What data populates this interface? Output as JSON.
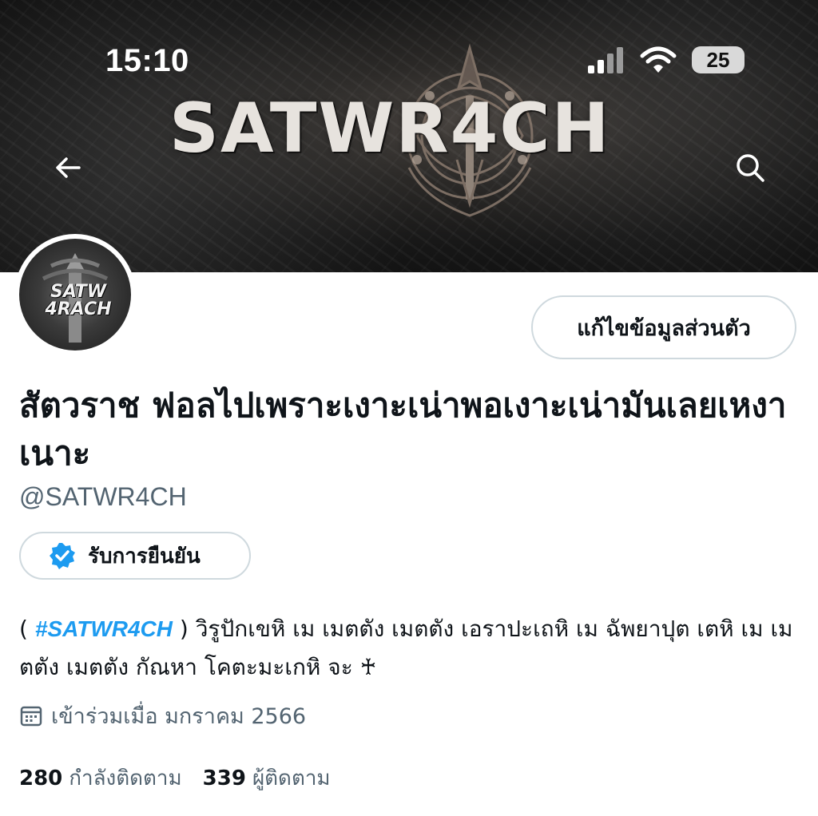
{
  "status_bar": {
    "time": "15:10",
    "battery": "25",
    "icons": [
      "signal-icon",
      "wifi-icon",
      "battery-icon"
    ]
  },
  "header": {
    "banner_text": "SATWR4CH",
    "back_icon": "arrow-left-icon",
    "search_icon": "search-icon"
  },
  "profile": {
    "avatar_text_line1": "SATW",
    "avatar_text_line2": "4RACH",
    "edit_button_label": "แก้ไขข้อมูลส่วนตัว",
    "display_name": "สัตวราช ฟอลไปเพราะเงาะเน่าพอเงาะเน่ามันเลยเหงาเนาะ",
    "handle": "@SATWR4CH",
    "verify_button_label": "รับการยืนยัน",
    "bio": {
      "open_paren": "( ",
      "hashtag": "#SATWR4CH",
      "text": " ) วิรูปักเขหิ เม เมตตัง เมตตัง เอราปะเถหิ เม ฉัพยาปุต เตหิ เม เมตตัง เมตตัง กัณหา โคตะมะเกหิ จะ ♰"
    },
    "joined": "เข้าร่วมเมื่อ มกราคม 2566",
    "following_count": "280",
    "following_label": "กำลังติดตาม",
    "followers_count": "339",
    "followers_label": "ผู้ติดตาม"
  },
  "colors": {
    "accent": "#1d9bf0",
    "text_primary": "#0f1419",
    "text_secondary": "#536471",
    "border": "#cfd9de"
  }
}
